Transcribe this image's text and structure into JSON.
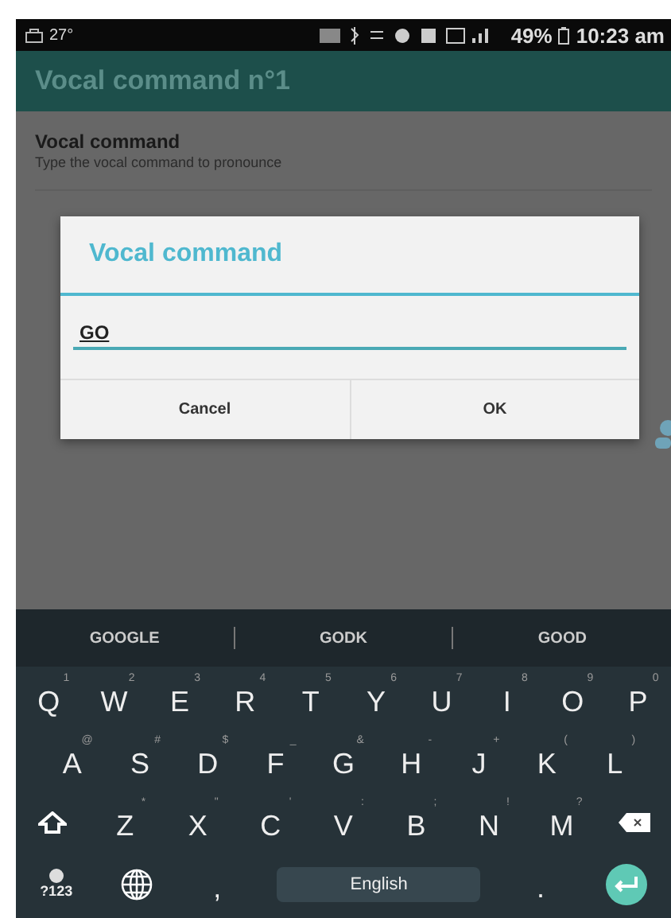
{
  "status_bar": {
    "temperature": "27°",
    "battery": "49%",
    "time": "10:23 am"
  },
  "app_bar": {
    "title": "Vocal command n°1"
  },
  "setting": {
    "title": "Vocal command",
    "subtitle": "Type the vocal command to pronounce"
  },
  "dialog": {
    "title": "Vocal command",
    "value": "GO",
    "buttons": [
      "Cancel",
      "OK"
    ]
  },
  "keyboard": {
    "suggestions": [
      "GOOGLE",
      "GODK",
      "GOOD"
    ],
    "rows": [
      [
        {
          "kind": "letter",
          "key": "Q",
          "hint": "1"
        },
        {
          "kind": "letter",
          "key": "W",
          "hint": "2"
        },
        {
          "kind": "letter",
          "key": "E",
          "hint": "3"
        },
        {
          "kind": "letter",
          "key": "R",
          "hint": "4"
        },
        {
          "kind": "letter",
          "key": "T",
          "hint": "5"
        },
        {
          "kind": "letter",
          "key": "Y",
          "hint": "6"
        },
        {
          "kind": "letter",
          "key": "U",
          "hint": "7"
        },
        {
          "kind": "letter",
          "key": "I",
          "hint": "8"
        },
        {
          "kind": "letter",
          "key": "O",
          "hint": "9"
        },
        {
          "kind": "letter",
          "key": "P",
          "hint": "0"
        }
      ],
      [
        {
          "kind": "letter",
          "key": "A",
          "hint": "@"
        },
        {
          "kind": "letter",
          "key": "S",
          "hint": "#"
        },
        {
          "kind": "letter",
          "key": "D",
          "hint": "$"
        },
        {
          "kind": "letter",
          "key": "F",
          "hint": "_"
        },
        {
          "kind": "letter",
          "key": "G",
          "hint": "&"
        },
        {
          "kind": "letter",
          "key": "H",
          "hint": "-"
        },
        {
          "kind": "letter",
          "key": "J",
          "hint": "+"
        },
        {
          "kind": "letter",
          "key": "K",
          "hint": "("
        },
        {
          "kind": "letter",
          "key": "L",
          "hint": ")"
        }
      ],
      [
        {
          "kind": "shift"
        },
        {
          "kind": "letter",
          "key": "Z",
          "hint": "*"
        },
        {
          "kind": "letter",
          "key": "X",
          "hint": "\""
        },
        {
          "kind": "letter",
          "key": "C",
          "hint": "'"
        },
        {
          "kind": "letter",
          "key": "V",
          "hint": ":"
        },
        {
          "kind": "letter",
          "key": "B",
          "hint": ";"
        },
        {
          "kind": "letter",
          "key": "N",
          "hint": "!"
        },
        {
          "kind": "letter",
          "key": "M",
          "hint": "?"
        },
        {
          "kind": "backspace"
        }
      ],
      [
        {
          "kind": "symbols",
          "key": "?123"
        },
        {
          "kind": "globe"
        },
        {
          "kind": "letter",
          "key": ","
        },
        {
          "kind": "space",
          "key": "English"
        },
        {
          "kind": "letter",
          "key": "."
        },
        {
          "kind": "enter"
        }
      ]
    ]
  }
}
